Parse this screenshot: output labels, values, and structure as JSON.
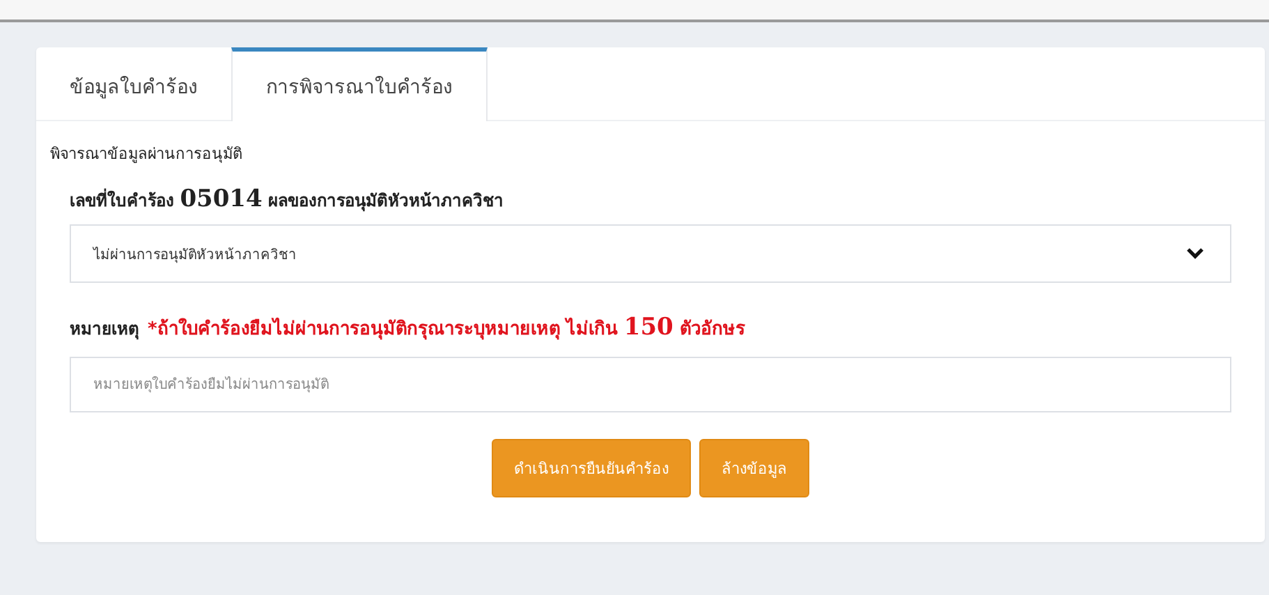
{
  "tabs": [
    {
      "label": "ข้อมูลใบคำร้อง",
      "selected": false
    },
    {
      "label": "การพิจารณาใบคำร้อง",
      "selected": true
    }
  ],
  "section_title": "พิจารณาข้อมูลผ่านการอนุมัติ",
  "decision": {
    "label": "เลขที่ใบคำร้อง **05014** ผลของการอนุมัติหัวหน้าภาควิชา",
    "value": "ไม่ผ่านการอนุมัติหัวหน้าภาควิชา"
  },
  "note": {
    "label": "หมายเหตุ",
    "warning": "*ถ้าใบคำร้องยืมไม่ผ่านการอนุมัติกรุณาระบุหมายเหตุ ไม่เกิน **150** ตัวอักษร",
    "placeholder": "หมายเหตุใบคำร้องยืมไม่ผ่านการอนุมัติ"
  },
  "buttons": [
    "ดำเนินการยืนยันคำร้อง",
    "ล้างข้อมูล"
  ]
}
